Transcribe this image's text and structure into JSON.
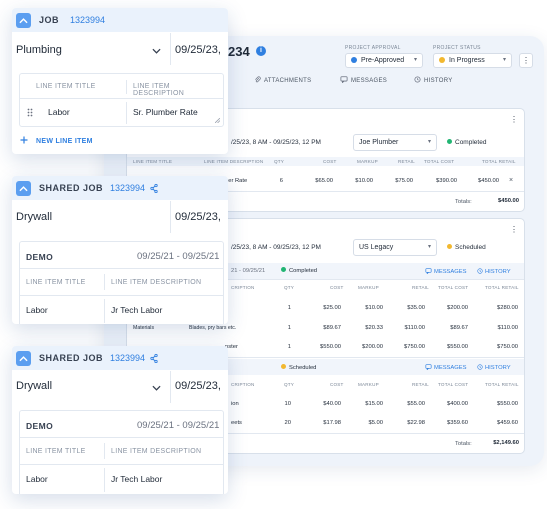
{
  "project": {
    "title_fragment": "234",
    "info_icon": "info-icon",
    "approval_label": "PROJECT APPROVAL",
    "approval_value": "Pre-Approved",
    "approval_color": "#2f7fe0",
    "status_label": "PROJECT STATUS",
    "status_value": "In Progress",
    "status_color": "#f2b82f"
  },
  "nav_tabs": [
    {
      "label": "ATTACHMENTS",
      "icon": "paperclip-icon"
    },
    {
      "label": "MESSAGES",
      "icon": "message-icon"
    },
    {
      "label": "HISTORY",
      "icon": "history-icon"
    }
  ],
  "job1": {
    "range": "/25/23, 8 AM  -  09/25/23, 12 PM",
    "assignee": "Joe Plumber",
    "status": "Completed",
    "status_color": "#22b573",
    "headers": [
      "LINE ITEM TITLE",
      "LINE ITEM DESCRIPTION",
      "QTY",
      "COST",
      "MARKUP",
      "RETAIL",
      "TOTAL COST",
      "TOTAL RETAIL"
    ],
    "row": {
      "desc": "ber Rate",
      "qty": "6",
      "cost": "$65.00",
      "markup": "$10.00",
      "retail": "$75.00",
      "total_cost": "$390.00",
      "total_retail": "$450.00",
      "remove": "×"
    },
    "totals_label": "Totals:",
    "totals_value": "$450.00"
  },
  "job2": {
    "range": "/25/23, 8 AM  -  09/25/23, 12 PM",
    "assignee": "US Legacy",
    "status": "Scheduled",
    "status_color": "#f2b82f",
    "visit1": {
      "range": "21  -  09/25/21",
      "status": "Completed",
      "status_color": "#22b573",
      "messages": "MESSAGES",
      "history": "HISTORY",
      "headers": [
        "CRIPTION",
        "QTY",
        "COST",
        "MARKUP",
        "RETAIL",
        "TOTAL COST",
        "TOTAL RETAIL"
      ],
      "rows": [
        {
          "title": "",
          "desc": "",
          "qty": "1",
          "cost": "$25.00",
          "markup": "$10.00",
          "retail": "$35.00",
          "total_cost": "$200.00",
          "total_retail": "$280.00"
        },
        {
          "title": "Materials",
          "desc": "Blades, pry bars etc.",
          "qty": "1",
          "cost": "$89.67",
          "markup": "$20.33",
          "retail": "$110.00",
          "total_cost": "$89.67",
          "total_retail": "$110.00"
        },
        {
          "title": "",
          "desc": "nster",
          "qty": "1",
          "cost": "$550.00",
          "markup": "$200.00",
          "retail": "$750.00",
          "total_cost": "$550.00",
          "total_retail": "$750.00"
        }
      ]
    },
    "visit2": {
      "status": "Scheduled",
      "status_color": "#f2b82f",
      "messages": "MESSAGES",
      "history": "HISTORY",
      "headers": [
        "CRIPTION",
        "QTY",
        "COST",
        "MARKUP",
        "RETAIL",
        "TOTAL COST",
        "TOTAL RETAIL"
      ],
      "rows": [
        {
          "desc": "ion",
          "qty": "10",
          "cost": "$40.00",
          "markup": "$15.00",
          "retail": "$55.00",
          "total_cost": "$400.00",
          "total_retail": "$550.00"
        },
        {
          "desc": "eets",
          "qty": "20",
          "cost": "$17.98",
          "markup": "$5.00",
          "retail": "$22.98",
          "total_cost": "$359.60",
          "total_retail": "$459.60"
        }
      ]
    },
    "totals_label": "Totals:",
    "totals_value": "$2,149.60"
  },
  "card_job": {
    "title": "JOB",
    "number": "1323994",
    "select": "Plumbing",
    "date": "09/25/23,",
    "col_title": "LINE ITEM TITLE",
    "col_desc": "LINE ITEM DESCRIPTION",
    "item_title": "Labor",
    "item_desc": "Sr. Plumber Rate",
    "new_line": "NEW LINE ITEM"
  },
  "card_shared1": {
    "title": "SHARED JOB",
    "number": "1323994",
    "select": "Drywall",
    "date": "09/25/23,",
    "demo": "DEMO",
    "demo_range": "09/25/21  -  09/25/21",
    "col_title": "LINE ITEM TITLE",
    "col_desc": "LINE ITEM DESCRIPTION",
    "item_title": "Labor",
    "item_desc": "Jr Tech Labor"
  },
  "card_shared2": {
    "title": "SHARED JOB",
    "number": "1323994",
    "select": "Drywall",
    "date": "09/25/23,",
    "demo": "DEMO",
    "demo_range": "09/25/21  -  09/25/21",
    "col_title": "LINE ITEM TITLE",
    "col_desc": "LINE ITEM DESCRIPTION",
    "item_title": "Labor",
    "item_desc": "Jr Tech Labor"
  }
}
